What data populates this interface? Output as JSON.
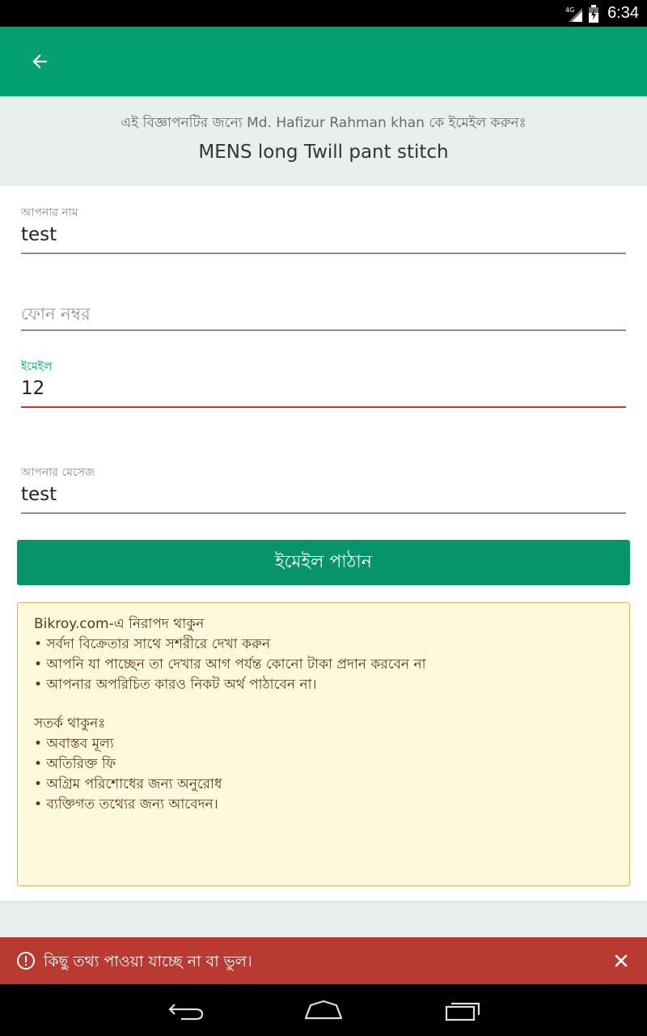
{
  "status_bar": {
    "network": "4G",
    "time": "6:34"
  },
  "app_bar": {
    "back_icon": "arrow-left-icon"
  },
  "header": {
    "subtitle": "এই বিজ্ঞাপনটির জন্যে Md. Hafizur Rahman khan কে ইমেইল করুনঃ",
    "ad_title": "MENS long Twill pant stitch"
  },
  "form": {
    "name": {
      "label": "আপনার নাম",
      "value": "test"
    },
    "phone": {
      "placeholder": "ফোন নম্বর",
      "value": ""
    },
    "email": {
      "label": "ইমেইল",
      "value": "12"
    },
    "message": {
      "label": "আপনার মেসেজ",
      "value": "test"
    },
    "send_label": "ইমেইল পাঠান"
  },
  "safety": {
    "title": "Bikroy.com-এ নিরাপদ থাকুন",
    "tips": [
      "• সর্বদা বিক্রেতার সাথে সশরীরে দেখা করুন",
      "• আপনি যা পাচ্ছেন তা দেখার আগ পর্যন্ত কোনো টাকা প্রদান করবেন না",
      "• আপনার অপরিচিত কারও নিকট অর্থ পাঠাবেন না।"
    ],
    "warning_title": "সতর্ক থাকুনঃ",
    "warnings": [
      "• অবাস্তব মূল্য",
      "• অতিরিক্ত ফি",
      "• অগ্রিম পরিশোধের জন্য অনুরোধ",
      "• ব্যক্তিগত তথ্যের জন্য আবেদন।"
    ]
  },
  "error_bar": {
    "message": "কিছু তথ্য পাওয়া যাচ্ছে না বা ভুল।"
  },
  "colors": {
    "primary": "#03a06f",
    "button": "#08946a",
    "error": "#b83a31",
    "warning_bg": "#fff8dc"
  }
}
